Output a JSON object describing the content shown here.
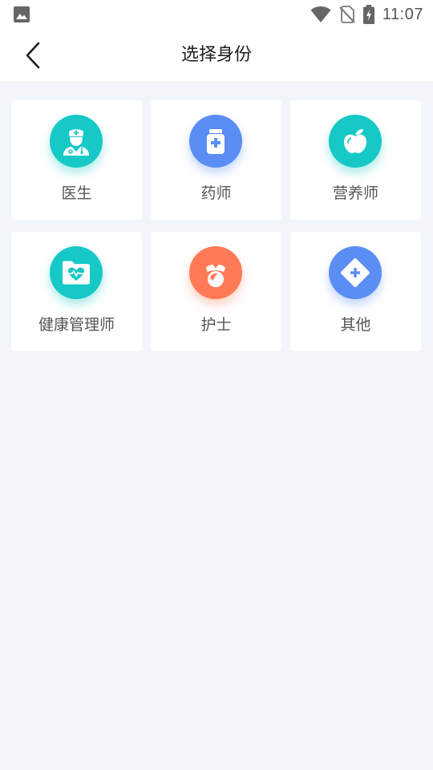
{
  "statusbar": {
    "time": "11:07",
    "icons": [
      "image-icon",
      "wifi-icon",
      "no-sim-icon",
      "battery-charging-icon"
    ]
  },
  "header": {
    "title": "选择身份",
    "back_icon": "back-arrow-icon"
  },
  "roles": [
    {
      "label": "医生",
      "icon": "doctor-icon",
      "color": "#16c9c6"
    },
    {
      "label": "药师",
      "icon": "medicine-bottle-icon",
      "color": "#5b8ef5"
    },
    {
      "label": "营养师",
      "icon": "apple-icon",
      "color": "#16c9c6"
    },
    {
      "label": "健康管理师",
      "icon": "health-folder-icon",
      "color": "#16c9c6"
    },
    {
      "label": "护士",
      "icon": "nurse-icon",
      "color": "#ff7a55"
    },
    {
      "label": "其他",
      "icon": "diamond-plus-icon",
      "color": "#5b8ef5"
    }
  ],
  "colors": {
    "background": "#f2f5f9",
    "card": "#ffffff",
    "teal": "#16c9c6",
    "blue": "#5b8ef5",
    "orange": "#ff7a55"
  }
}
